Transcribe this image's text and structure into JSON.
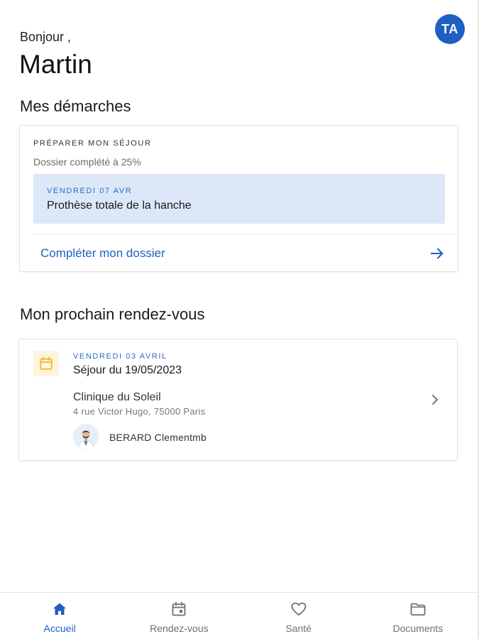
{
  "header": {
    "avatar_initials": "TA",
    "greeting": "Bonjour ,",
    "user_name": "Martin"
  },
  "demarches": {
    "section_title": "Mes démarches",
    "overline": "PRÉPARER MON SÉJOUR",
    "progress_text": "Dossier complété à 25%",
    "progress_value": 0.25,
    "event": {
      "date": "VENDREDI 07 AVR",
      "name": "Prothèse totale de la hanche"
    },
    "action_label": "Compléter mon dossier"
  },
  "rendezvous": {
    "section_title": "Mon prochain rendez-vous",
    "date": "VENDREDI 03 AVRIL",
    "title": "Séjour du 19/05/2023",
    "clinic_name": "Clinique du Soleil",
    "clinic_address": "4 rue Victor Hugo, 75000 Paris",
    "doctor_name": "BERARD Clementmb"
  },
  "nav": {
    "items": [
      {
        "label": "Accueil",
        "icon": "home-icon",
        "active": true
      },
      {
        "label": "Rendez-vous",
        "icon": "calendar-icon",
        "active": false
      },
      {
        "label": "Santé",
        "icon": "heart-icon",
        "active": false
      },
      {
        "label": "Documents",
        "icon": "folder-icon",
        "active": false
      }
    ]
  },
  "colors": {
    "accent": "#1f5fc2",
    "event_background": "#dce8f8",
    "calendar_tile": "#fff4dc",
    "calendar_icon": "#f2b632"
  }
}
